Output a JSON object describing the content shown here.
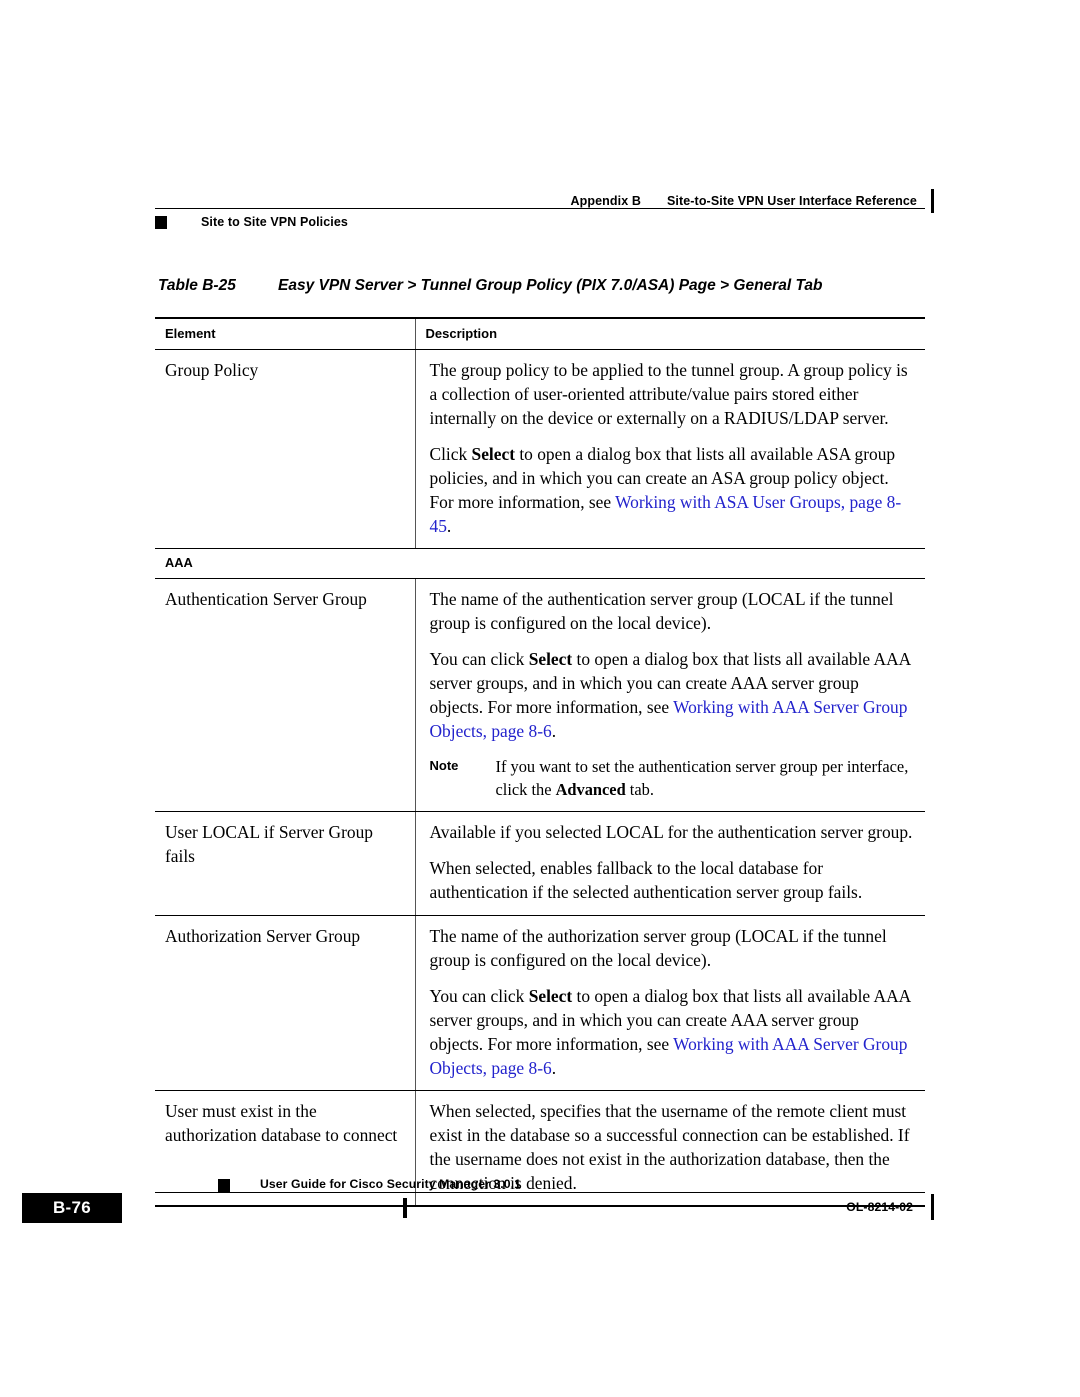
{
  "header": {
    "appendix": "Appendix B",
    "title": "Site-to-Site VPN User Interface Reference",
    "section": "Site to Site VPN Policies"
  },
  "caption": {
    "number": "Table B-25",
    "text": "Easy VPN Server > Tunnel Group Policy (PIX 7.0/ASA) Page > General Tab"
  },
  "table": {
    "columns": {
      "element": "Element",
      "description": "Description"
    },
    "rows": [
      {
        "type": "data",
        "element": "Group Policy",
        "paragraphs": [
          {
            "segments": [
              {
                "text": "The group policy to be applied to the tunnel group. A group policy is a collection of user-oriented attribute/value pairs stored either internally on the device or externally on a RADIUS/LDAP server.",
                "style": "normal"
              }
            ]
          },
          {
            "segments": [
              {
                "text": "Click ",
                "style": "normal"
              },
              {
                "text": "Select",
                "style": "bold"
              },
              {
                "text": " to open a dialog box that lists all available ASA group policies, and in which you can create an ASA group policy object. For more information, see ",
                "style": "normal"
              },
              {
                "text": "Working with ASA User Groups, page 8-45",
                "style": "link"
              },
              {
                "text": ".",
                "style": "normal"
              }
            ]
          }
        ]
      },
      {
        "type": "section",
        "element": "AAA"
      },
      {
        "type": "data",
        "element": "Authentication Server Group",
        "paragraphs": [
          {
            "segments": [
              {
                "text": "The name of the authentication server group (LOCAL if the tunnel group is configured on the local device).",
                "style": "normal"
              }
            ]
          },
          {
            "segments": [
              {
                "text": "You can click ",
                "style": "normal"
              },
              {
                "text": "Select",
                "style": "bold"
              },
              {
                "text": " to open a dialog box that lists all available AAA server groups, and in which you can create AAA server group objects. For more information, see ",
                "style": "normal"
              },
              {
                "text": "Working with AAA Server Group Objects, page 8-6",
                "style": "link"
              },
              {
                "text": ".",
                "style": "normal"
              }
            ]
          }
        ],
        "note": {
          "label": "Note",
          "segments": [
            {
              "text": "If you want to set the authentication server group per interface, click the ",
              "style": "normal"
            },
            {
              "text": "Advanced",
              "style": "bold"
            },
            {
              "text": " tab.",
              "style": "normal"
            }
          ]
        }
      },
      {
        "type": "data",
        "element": "User LOCAL if Server Group fails",
        "paragraphs": [
          {
            "segments": [
              {
                "text": "Available if you selected LOCAL for the authentication server group.",
                "style": "normal"
              }
            ]
          },
          {
            "segments": [
              {
                "text": "When selected, enables fallback to the local database for authentication if the selected authentication server group fails.",
                "style": "normal"
              }
            ]
          }
        ]
      },
      {
        "type": "data",
        "element": "Authorization Server Group",
        "paragraphs": [
          {
            "segments": [
              {
                "text": "The name of the authorization server group (LOCAL if the tunnel group is configured on the local device).",
                "style": "normal"
              }
            ]
          },
          {
            "segments": [
              {
                "text": "You can click ",
                "style": "normal"
              },
              {
                "text": "Select",
                "style": "bold"
              },
              {
                "text": " to open a dialog box that lists all available AAA server groups, and in which you can create AAA server group objects. For more information, see ",
                "style": "normal"
              },
              {
                "text": "Working with AAA Server Group Objects, page 8-6",
                "style": "link"
              },
              {
                "text": ".",
                "style": "normal"
              }
            ]
          }
        ]
      },
      {
        "type": "data",
        "element": "User must exist in the authorization database to connect",
        "paragraphs": [
          {
            "segments": [
              {
                "text": "When selected, specifies that the username of the remote client must exist in the database so a successful connection can be established. If the username does not exist in the authorization database, then the connection is denied.",
                "style": "normal"
              }
            ]
          }
        ]
      }
    ]
  },
  "footer": {
    "guide": "User Guide for Cisco Security Manager 3.0.1",
    "page": "B-76",
    "doc_id": "OL-8214-02"
  },
  "colors": {
    "link": "#2222CC",
    "text": "#000000",
    "background": "#FFFFFF"
  }
}
